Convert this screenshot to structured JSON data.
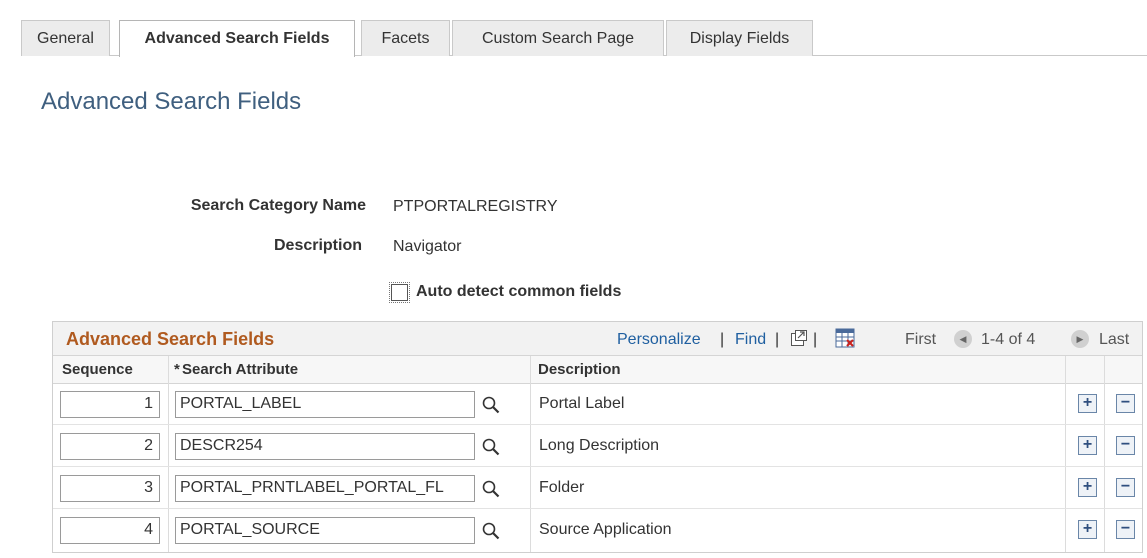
{
  "tabs": [
    {
      "label": "General"
    },
    {
      "label": "Advanced Search Fields",
      "active": true
    },
    {
      "label": "Facets"
    },
    {
      "label": "Custom Search Page"
    },
    {
      "label": "Display Fields"
    }
  ],
  "page_title": "Advanced Search Fields",
  "form": {
    "category_label": "Search Category Name",
    "category_value": "PTPORTALREGISTRY",
    "description_label": "Description",
    "description_value": "Navigator",
    "auto_detect_label": "Auto detect common fields",
    "auto_detect_checked": false
  },
  "grid": {
    "title": "Advanced Search Fields",
    "personalize": "Personalize",
    "sep": "|",
    "find": "Find",
    "first": "First",
    "range": "1-4 of 4",
    "last": "Last",
    "columns": {
      "sequence": "Sequence",
      "required_mark": "*",
      "search_attribute": "Search Attribute",
      "description": "Description"
    },
    "rows": [
      {
        "sequence": "1",
        "attribute": "PORTAL_LABEL",
        "description": "Portal Label"
      },
      {
        "sequence": "2",
        "attribute": "DESCR254",
        "description": "Long Description"
      },
      {
        "sequence": "3",
        "attribute": "PORTAL_PRNTLABEL_PORTAL_FL",
        "description": "Folder"
      },
      {
        "sequence": "4",
        "attribute": "PORTAL_SOURCE",
        "description": "Source Application"
      }
    ],
    "add_symbol": "+",
    "delete_symbol": "−"
  },
  "icons": {
    "lookup": "magnifier-icon",
    "new_window": "new-window-icon",
    "download": "spreadsheet-download-icon",
    "prev": "left-arrow-icon",
    "next": "right-arrow-icon"
  },
  "colors": {
    "title": "#3f5f7f",
    "grid_title": "#b05a1f",
    "link": "#1f5fa0"
  }
}
